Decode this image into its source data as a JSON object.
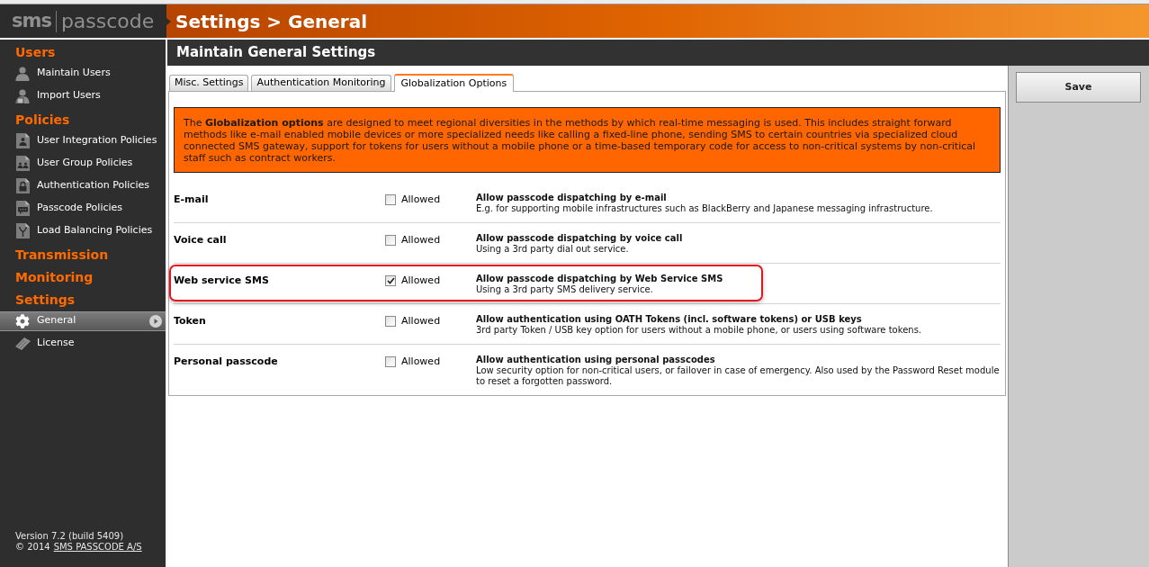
{
  "logo": {
    "mark": "sms",
    "name": "passcode"
  },
  "header": {
    "title": "Settings > General"
  },
  "sidebar": {
    "sections": [
      {
        "heading": "Users",
        "items": [
          {
            "label": "Maintain Users",
            "selected": false
          },
          {
            "label": "Import Users",
            "selected": false
          }
        ]
      },
      {
        "heading": "Policies",
        "items": [
          {
            "label": "User Integration Policies",
            "selected": false
          },
          {
            "label": "User Group Policies",
            "selected": false
          },
          {
            "label": "Authentication Policies",
            "selected": false
          },
          {
            "label": "Passcode Policies",
            "selected": false
          },
          {
            "label": "Load Balancing Policies",
            "selected": false
          }
        ]
      },
      {
        "heading": "Transmission"
      },
      {
        "heading": "Monitoring"
      },
      {
        "heading": "Settings",
        "items": [
          {
            "label": "General",
            "selected": true
          },
          {
            "label": "License",
            "selected": false
          }
        ]
      }
    ],
    "version": "Version 7.2 (build 5409)",
    "copyright": "© 2014",
    "company_link": "SMS PASSCODE A/S"
  },
  "page_title": "Maintain General Settings",
  "tabs": [
    {
      "label": "Misc. Settings",
      "selected": false
    },
    {
      "label": "Authentication Monitoring",
      "selected": false
    },
    {
      "label": "Globalization Options",
      "selected": true
    }
  ],
  "info_box": {
    "text": "The **Globalization options** are designed to meet regional diversities in the methods by which real-time messaging is used. This includes straight forward methods like e-mail enabled mobile devices or more specialized needs like calling a fixed-line phone, sending SMS to certain countries via specialized cloud connected SMS gateway, support for tokens for users without a mobile phone or a time-based temporary code for access to non-critical systems by non-critical staff such as contract workers."
  },
  "options": [
    {
      "label": "E-mail",
      "checked": false,
      "checkbox_label": "Allowed",
      "title": "Allow passcode dispatching by e-mail",
      "description": "E.g. for supporting mobile infrastructures such as BlackBerry and Japanese messaging infrastructure.",
      "highlighted": false
    },
    {
      "label": "Voice call",
      "checked": false,
      "checkbox_label": "Allowed",
      "title": "Allow passcode dispatching by voice call",
      "description": "Using a 3rd party dial out service.",
      "highlighted": false
    },
    {
      "label": "Web service SMS",
      "checked": true,
      "checkbox_label": "Allowed",
      "title": "Allow passcode dispatching by Web Service SMS",
      "description": "Using a 3rd party SMS delivery service.",
      "highlighted": true
    },
    {
      "label": "Token",
      "checked": false,
      "checkbox_label": "Allowed",
      "title": "Allow authentication using OATH Tokens (incl. software tokens) or USB keys",
      "description": "3rd party Token / USB key option for users without a mobile phone, or users using software tokens.",
      "highlighted": false
    },
    {
      "label": "Personal passcode",
      "checked": false,
      "checkbox_label": "Allowed",
      "title": "Allow authentication using personal passcodes",
      "description": "Low security option for non-critical users, or failover in case of emergency. Also used by the Password Reset module to reset a forgotten password.",
      "highlighted": false
    }
  ],
  "save_button": "Save"
}
